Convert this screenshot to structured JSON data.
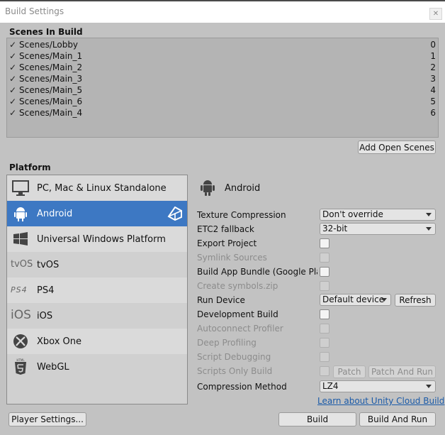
{
  "window": {
    "title": "Build Settings",
    "close": "✕"
  },
  "scenes": {
    "label": "Scenes In Build",
    "items": [
      {
        "name": "Scenes/Lobby",
        "index": "0",
        "checked": "✓"
      },
      {
        "name": "Scenes/Main_1",
        "index": "1",
        "checked": "✓"
      },
      {
        "name": "Scenes/Main_2",
        "index": "2",
        "checked": "✓"
      },
      {
        "name": "Scenes/Main_3",
        "index": "3",
        "checked": "✓"
      },
      {
        "name": "Scenes/Main_5",
        "index": "4",
        "checked": "✓"
      },
      {
        "name": "Scenes/Main_6",
        "index": "5",
        "checked": "✓"
      },
      {
        "name": "Scenes/Main_4",
        "index": "6",
        "checked": "✓"
      }
    ],
    "add_open_scenes": "Add Open Scenes"
  },
  "platform": {
    "label": "Platform",
    "items": [
      {
        "name": "PC, Mac & Linux Standalone",
        "icon": "monitor-icon"
      },
      {
        "name": "Android",
        "icon": "android-icon",
        "selected": true
      },
      {
        "name": "Universal Windows Platform",
        "icon": "windows-icon"
      },
      {
        "name": "tvOS",
        "icon": "tvos-icon",
        "logo": "tvOS"
      },
      {
        "name": "PS4",
        "icon": "ps4-icon",
        "logo": "PS4"
      },
      {
        "name": "iOS",
        "icon": "ios-icon",
        "logo": "iOS"
      },
      {
        "name": "Xbox One",
        "icon": "xbox-icon"
      },
      {
        "name": "WebGL",
        "icon": "html5-icon",
        "logo": "HTML"
      }
    ]
  },
  "settings": {
    "title": "Android",
    "texture_compression": {
      "label": "Texture Compression",
      "value": "Don't override"
    },
    "etc2_fallback": {
      "label": "ETC2 fallback",
      "value": "32-bit"
    },
    "export_project": "Export Project",
    "symlink_sources": "Symlink Sources",
    "build_app_bundle": "Build App Bundle (Google Play)",
    "create_symbols": "Create symbols.zip",
    "run_device": {
      "label": "Run Device",
      "value": "Default device",
      "refresh": "Refresh"
    },
    "development_build": "Development Build",
    "autoconnect_profiler": "Autoconnect Profiler",
    "deep_profiling": "Deep Profiling",
    "script_debugging": "Script Debugging",
    "scripts_only_build": {
      "label": "Scripts Only Build",
      "patch": "Patch",
      "patch_and_run": "Patch And Run"
    },
    "compression_method": {
      "label": "Compression Method",
      "value": "LZ4"
    },
    "cloud_build_link": "Learn about Unity Cloud Build"
  },
  "footer": {
    "player_settings": "Player Settings...",
    "build": "Build",
    "build_and_run": "Build And Run"
  }
}
